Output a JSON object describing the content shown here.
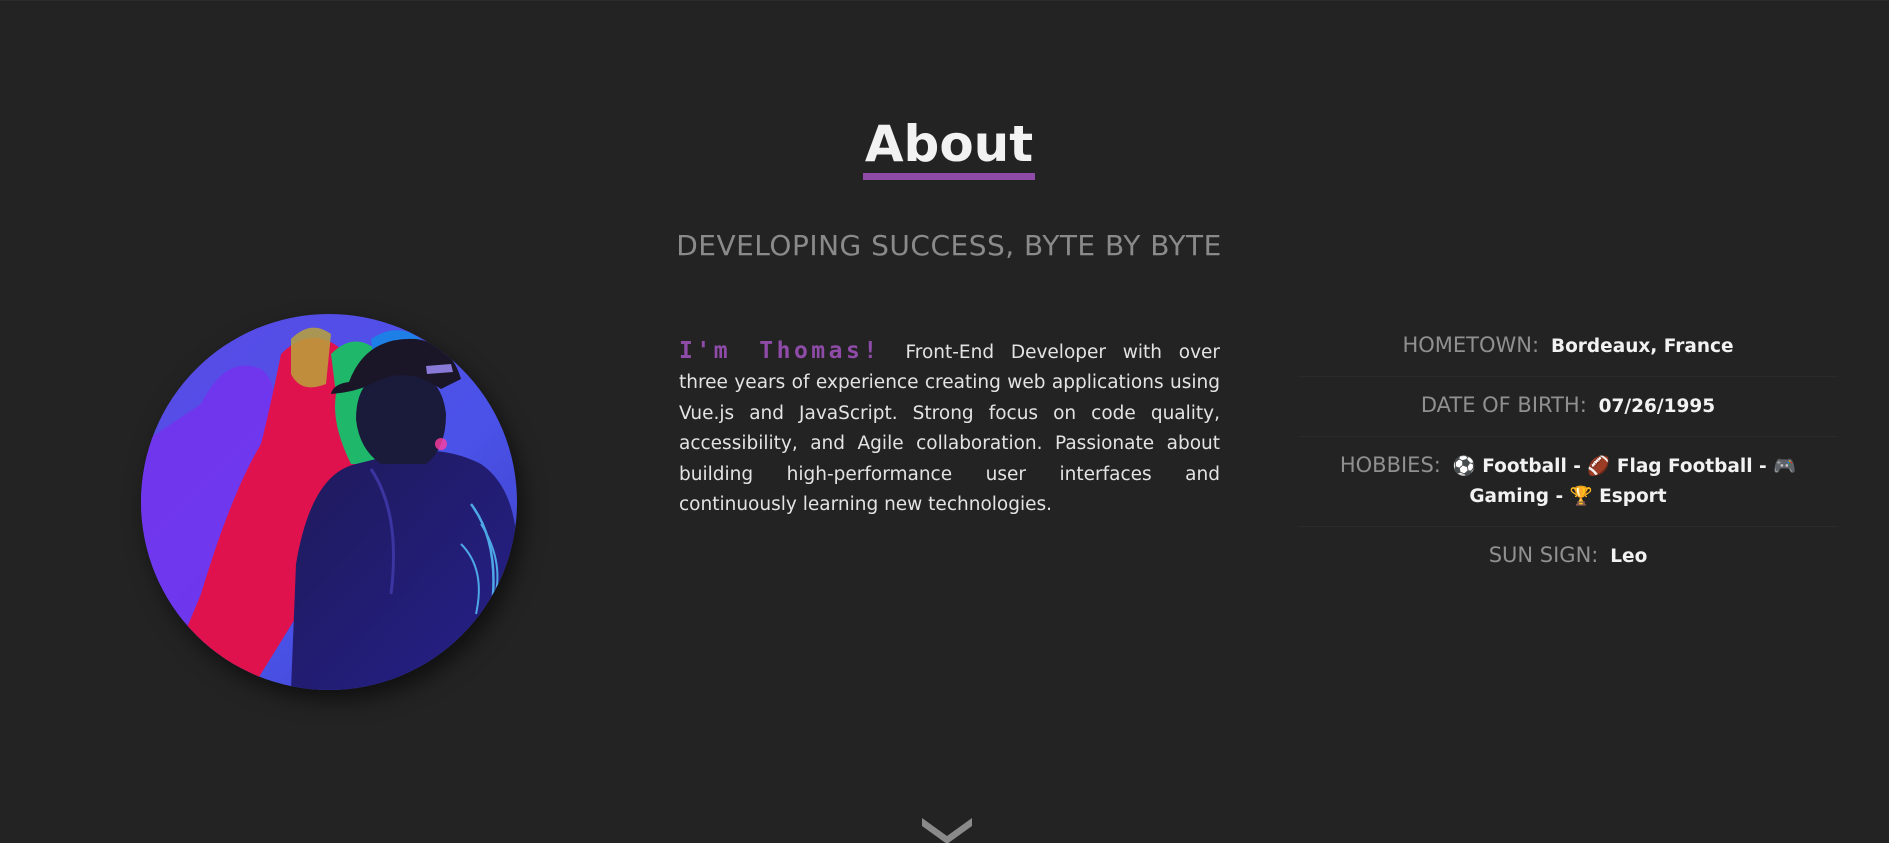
{
  "section": {
    "title": "About",
    "subtitle": "DEVELOPING SUCCESS, BYTE BY BYTE"
  },
  "bio": {
    "greeting": "I'm Thomas!",
    "text": "Front-End Developer with over three years of experience creating web applications using Vue.js and JavaScript. Strong focus on code quality, accessibility, and Agile collaboration. Passionate about building high-performance user interfaces and continuously learning new technologies."
  },
  "facts": [
    {
      "label": "HOMETOWN:",
      "value": "Bordeaux, France"
    },
    {
      "label": "DATE OF BIRTH:",
      "value": "07/26/1995"
    },
    {
      "label": "HOBBIES:",
      "value": "⚽ Football - 🏈 Flag Football - 🎮 Gaming - 🏆 Esport"
    },
    {
      "label": "SUN SIGN:",
      "value": "Leo"
    }
  ],
  "colors": {
    "background": "#232323",
    "accent": "#8e4ba8",
    "muted": "#8a8a8a",
    "text": "#e3e3e3"
  },
  "icons": {
    "scroll": "chevron-down-icon"
  }
}
